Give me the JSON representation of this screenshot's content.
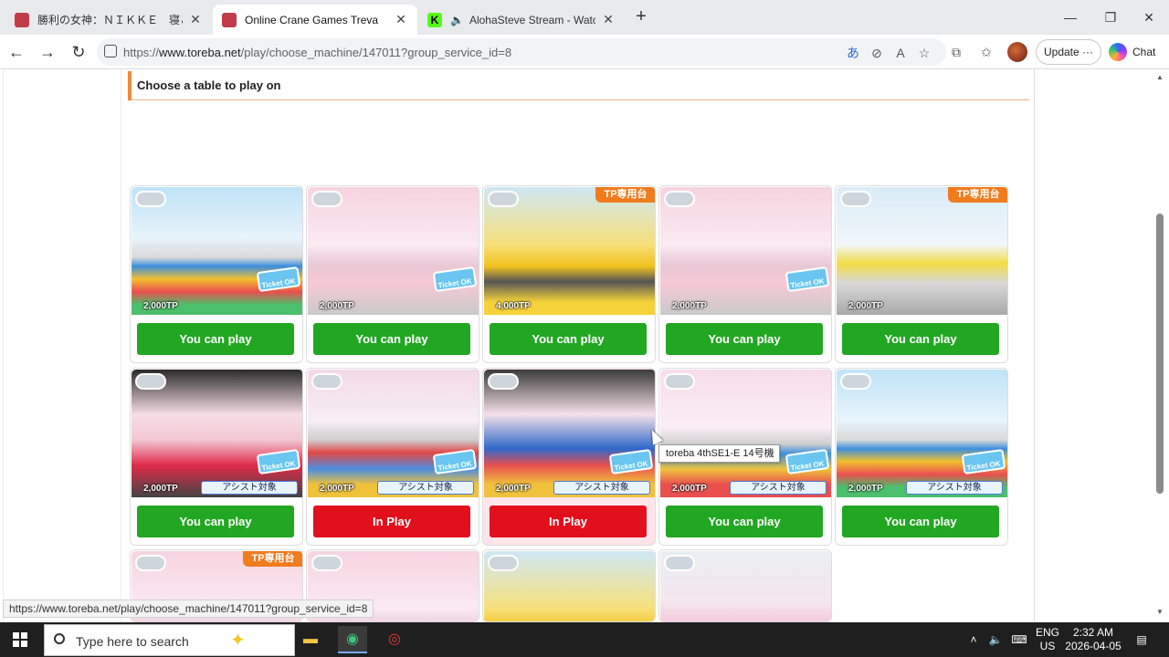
{
  "browser": {
    "tabs": [
      {
        "title": "勝利の女神：ＮＩＫＫＥ　寝ころび",
        "active": false,
        "favicon_color": "#c23b4a"
      },
      {
        "title": "Online Crane Games Treva",
        "active": true,
        "favicon_color": "#c23b4a"
      },
      {
        "title": "AlohaSteve Stream - Watch Li",
        "active": false,
        "favicon_color": "#53fc18"
      }
    ],
    "url_prefix": "https://",
    "url_host": "www.toreba.net",
    "url_path": "/play/choose_machine/147011?group_service_id=8",
    "update_label": "Update",
    "chat_label": "Chat"
  },
  "page": {
    "section_title": "Choose a table to play on",
    "tooltip": "toreba 4thSE1-E 14号機",
    "status_url": "https://www.toreba.net/play/choose_machine/147011?group_service_id=8"
  },
  "machines": [
    {
      "price": "2,000TP",
      "button": "You can play",
      "state": "available",
      "tp_only": "",
      "assist": "",
      "ticket": "Ticket OK",
      "scene": "balls"
    },
    {
      "price": "2,000TP",
      "button": "You can play",
      "state": "available",
      "tp_only": "",
      "assist": "",
      "ticket": "Ticket OK",
      "scene": "pink"
    },
    {
      "price": "4,000TP",
      "button": "You can play",
      "state": "available",
      "tp_only": "TP専用台",
      "assist": "",
      "ticket": "",
      "scene": "yellow"
    },
    {
      "price": "2,000TP",
      "button": "You can play",
      "state": "available",
      "tp_only": "",
      "assist": "",
      "ticket": "Ticket OK",
      "scene": "pink"
    },
    {
      "price": "2,000TP",
      "button": "You can play",
      "state": "available",
      "tp_only": "TP専用台",
      "assist": "",
      "ticket": "",
      "scene": "yellow2"
    },
    {
      "price": "2,000TP",
      "button": "You can play",
      "state": "available",
      "tp_only": "",
      "assist": "アシスト対象",
      "ticket": "Ticket OK",
      "scene": "dark"
    },
    {
      "price": "2,000TP",
      "button": "In Play",
      "state": "inplay",
      "tp_only": "",
      "assist": "アシスト対象",
      "ticket": "Ticket OK",
      "scene": "balls2"
    },
    {
      "price": "2,000TP",
      "button": "In Play",
      "state": "inplay",
      "tp_only": "",
      "assist": "アシスト対象",
      "ticket": "Ticket OK",
      "scene": "dark2"
    },
    {
      "price": "2,000TP",
      "button": "You can play",
      "state": "available",
      "tp_only": "",
      "assist": "アシスト対象",
      "ticket": "Ticket OK",
      "scene": "balls3"
    },
    {
      "price": "2,000TP",
      "button": "You can play",
      "state": "available",
      "tp_only": "",
      "assist": "アシスト対象",
      "ticket": "Ticket OK",
      "scene": "balls"
    },
    {
      "price": "",
      "button": "",
      "state": "partial",
      "tp_only": "TP専用台",
      "assist": "",
      "ticket": "",
      "scene": "pink"
    },
    {
      "price": "",
      "button": "",
      "state": "partial",
      "tp_only": "",
      "assist": "",
      "ticket": "",
      "scene": "pink"
    },
    {
      "price": "",
      "button": "",
      "state": "partial",
      "tp_only": "",
      "assist": "",
      "ticket": "",
      "scene": "yellow"
    },
    {
      "price": "",
      "button": "",
      "state": "partial",
      "tp_only": "",
      "assist": "",
      "ticket": "",
      "scene": "pink2"
    }
  ],
  "taskbar": {
    "search_placeholder": "Type here to search",
    "lang_top": "ENG",
    "lang_bottom": "US",
    "time": "2:32 AM",
    "date": "2026-04-05"
  },
  "colors": {
    "accent_orange": "#f08a3a",
    "play_green": "#22a722",
    "inplay_red": "#e20f1d"
  }
}
